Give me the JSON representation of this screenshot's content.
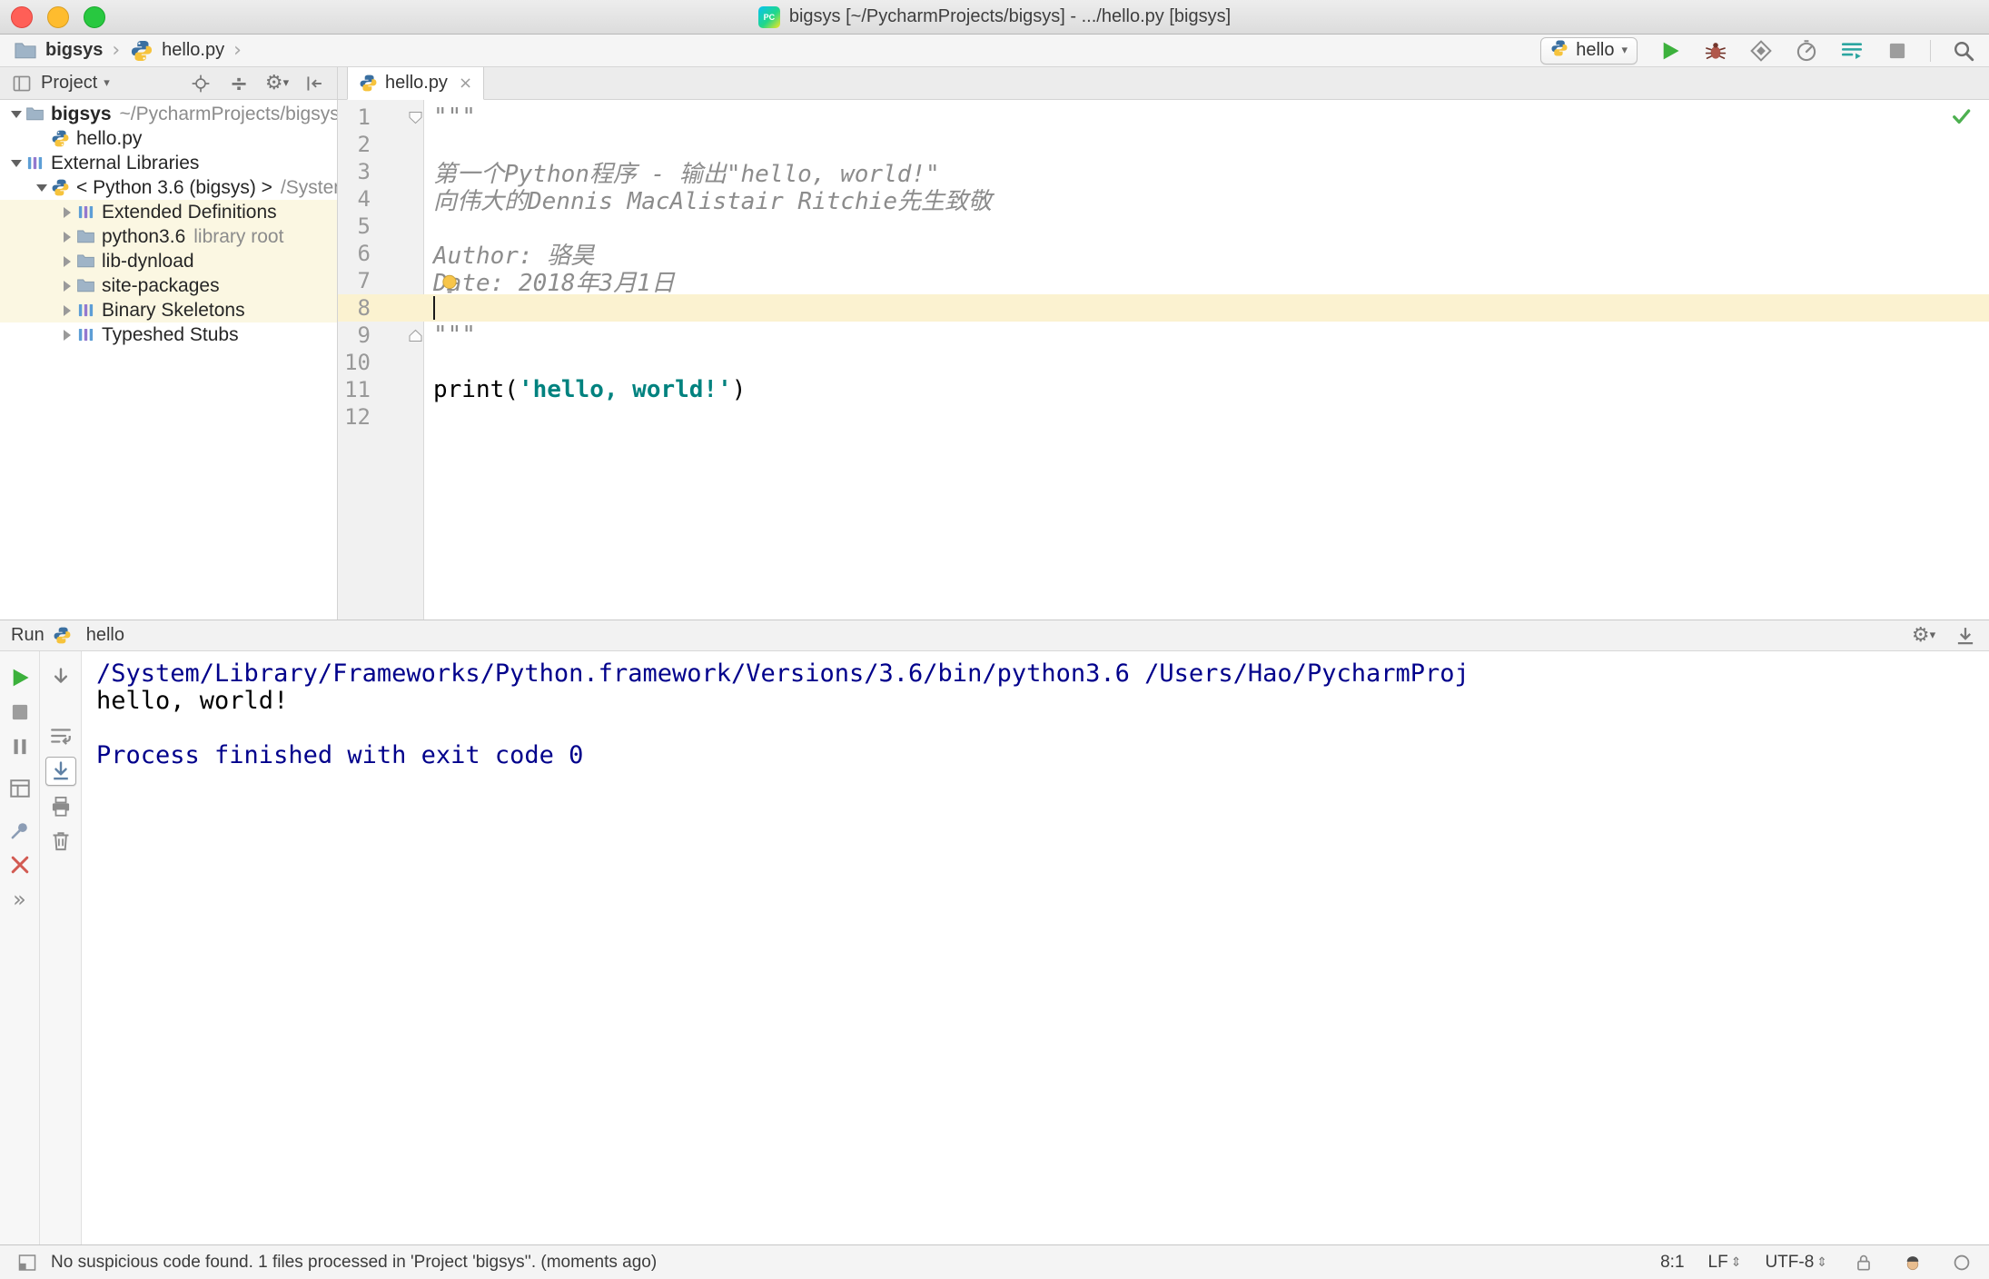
{
  "window": {
    "title": "bigsys [~/PycharmProjects/bigsys] - .../hello.py [bigsys]"
  },
  "icons": {
    "pycharm_label": "PC",
    "crumb_sep": "›",
    "dropdown": "▾",
    "gear": "⚙",
    "collapse_all": "÷",
    "tab_close": "×",
    "more": "»",
    "updown": "⇕"
  },
  "breadcrumbs": {
    "items": [
      "bigsys",
      "hello.py"
    ]
  },
  "nav": {
    "run_config": "hello"
  },
  "project_panel": {
    "title": "Project",
    "tree": [
      {
        "label": "bigsys",
        "annotation": "~/PycharmProjects/bigsys",
        "level": 0,
        "arrow": "expanded",
        "icon": "folder",
        "bold": true
      },
      {
        "label": "hello.py",
        "level": 1,
        "arrow": "none",
        "icon": "pyfile"
      },
      {
        "label": "External Libraries",
        "level": 0,
        "arrow": "expanded",
        "icon": "lib"
      },
      {
        "label": "< Python 3.6 (bigsys) >",
        "annotation": "/System",
        "level": 1,
        "arrow": "expanded",
        "icon": "python"
      },
      {
        "label": "Extended Definitions",
        "level": 2,
        "arrow": "collapsed",
        "icon": "lib",
        "highlighted": true
      },
      {
        "label": "python3.6",
        "annotation": "library root",
        "level": 2,
        "arrow": "collapsed",
        "icon": "folder",
        "highlighted": true
      },
      {
        "label": "lib-dynload",
        "level": 2,
        "arrow": "collapsed",
        "icon": "folder",
        "highlighted": true
      },
      {
        "label": "site-packages",
        "level": 2,
        "arrow": "collapsed",
        "icon": "folder",
        "highlighted": true
      },
      {
        "label": "Binary Skeletons",
        "level": 2,
        "arrow": "collapsed",
        "icon": "lib",
        "highlighted": true
      },
      {
        "label": "Typeshed Stubs",
        "level": 2,
        "arrow": "collapsed",
        "icon": "lib"
      }
    ]
  },
  "editor": {
    "tab": "hello.py",
    "lines": [
      {
        "num": 1,
        "fold": "open-top",
        "segments": [
          {
            "t": "\"\"\"",
            "s": "doc"
          }
        ]
      },
      {
        "num": 2,
        "segments": []
      },
      {
        "num": 3,
        "segments": [
          {
            "t": "第一个Python程序 - 输出\"hello, world!\"",
            "s": "doc"
          }
        ]
      },
      {
        "num": 4,
        "segments": [
          {
            "t": "向伟大的Dennis MacAlistair Ritchie先生致敬",
            "s": "doc"
          }
        ]
      },
      {
        "num": 5,
        "segments": []
      },
      {
        "num": 6,
        "segments": [
          {
            "t": "Author: 骆昊",
            "s": "doc"
          }
        ]
      },
      {
        "num": 7,
        "segments": [
          {
            "t": "Date: 2018年3月1日",
            "s": "doc"
          }
        ]
      },
      {
        "num": 8,
        "current": true,
        "segments": []
      },
      {
        "num": 9,
        "fold": "open-bottom",
        "segments": [
          {
            "t": "\"\"\"",
            "s": "doc"
          }
        ]
      },
      {
        "num": 10,
        "segments": []
      },
      {
        "num": 11,
        "segments": [
          {
            "t": "print",
            "s": "plain"
          },
          {
            "t": "(",
            "s": "plain"
          },
          {
            "t": "'hello, world!'",
            "s": "str"
          },
          {
            "t": ")",
            "s": "plain"
          }
        ]
      },
      {
        "num": 12,
        "segments": []
      }
    ]
  },
  "run_panel": {
    "title": "Run",
    "config": "hello",
    "console": [
      {
        "t": "/System/Library/Frameworks/Python.framework/Versions/3.6/bin/python3.6 /Users/Hao/PycharmProj",
        "s": "system"
      },
      {
        "t": "hello, world!",
        "s": "stdout"
      },
      {
        "t": "",
        "s": "stdout"
      },
      {
        "t": "Process finished with exit code 0",
        "s": "system"
      }
    ]
  },
  "status_bar": {
    "message": "No suspicious code found. 1 files processed in 'Project 'bigsys''. (moments ago)",
    "position": "8:1",
    "line_separator": "LF",
    "encoding": "UTF-8"
  }
}
